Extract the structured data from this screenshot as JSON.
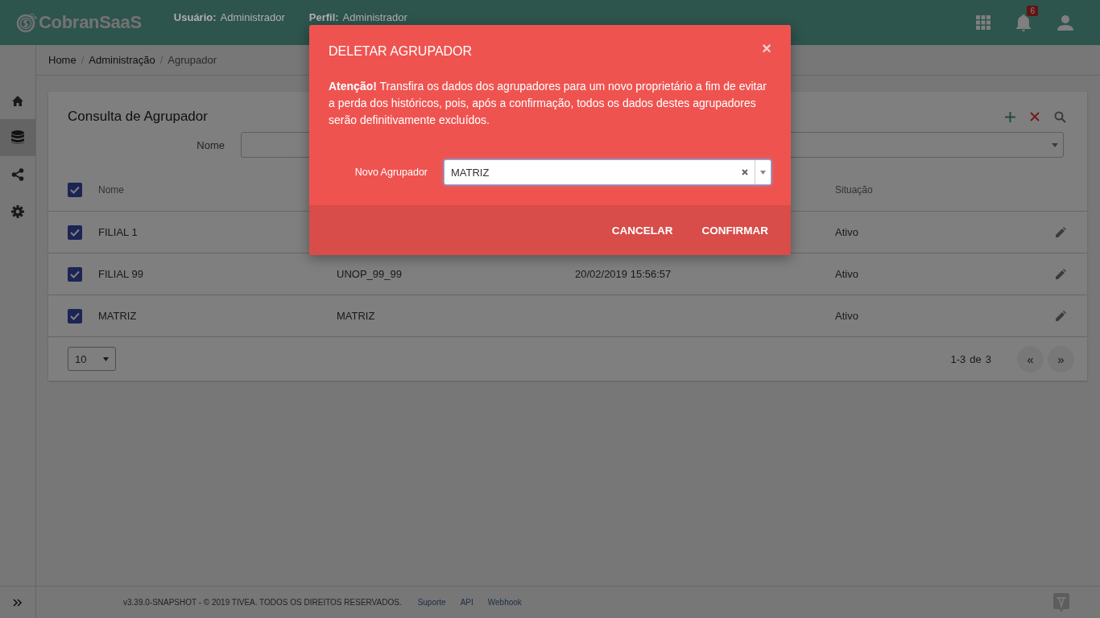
{
  "header": {
    "brand": "CobranSaaS",
    "user_label": "Usuário:",
    "user_value": "Administrador",
    "profile_label": "Perfil:",
    "profile_value": "Administrador",
    "notification_count": "6"
  },
  "sidebar": {
    "items": [
      {
        "selected": false
      },
      {
        "selected": true
      },
      {
        "selected": false
      },
      {
        "selected": false
      }
    ]
  },
  "breadcrumb": {
    "separator": "/",
    "items": [
      "Home",
      "Administração",
      "Agrupador"
    ]
  },
  "panel": {
    "title": "Consulta de Agrupador",
    "filter_label": "Nome"
  },
  "table": {
    "header": {
      "nome": "Nome",
      "situacao": "Situação",
      "checked": true
    },
    "rows": [
      {
        "checked": true,
        "nome": "FILIAL 1",
        "situacao": "Ativo"
      },
      {
        "checked": true,
        "nome": "FILIAL 99",
        "column_2": "UNOP_99_99",
        "column_3": "20/02/2019 15:56:57",
        "situacao": "Ativo"
      },
      {
        "checked": true,
        "nome": "MATRIZ",
        "column_2": "MATRIZ",
        "situacao": "Ativo"
      }
    ]
  },
  "pager": {
    "page_size": "10",
    "range": "1-3",
    "of": "de",
    "total": "3",
    "prev": "«",
    "next": "»"
  },
  "footer": {
    "copyright": "v3.39.0-SNAPSHOT - © 2019 TIVEA. TODOS OS DIREITOS RESERVADOS.",
    "links": [
      "Suporte",
      "API",
      "Webhook"
    ]
  },
  "dialog": {
    "title": "DELETAR AGRUPADOR",
    "close": "×",
    "message": "**Atenção!** Transfira os dados dos agrupadores para um novo proprietário a fim de evitar a perda dos históricos, pois, após a confirmação, todos os dados destes agrupadores serão definitivamente excluídos.",
    "field_label": "Novo Agrupador",
    "field_value": "MATRIZ",
    "buttons": [
      "CANCELAR",
      "CONFIRMAR"
    ]
  }
}
